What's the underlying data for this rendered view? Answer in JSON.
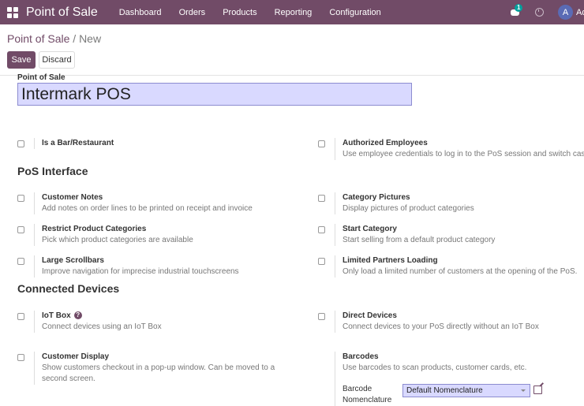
{
  "navbar": {
    "brand": "Point of Sale",
    "menu": [
      "Dashboard",
      "Orders",
      "Products",
      "Reporting",
      "Configuration"
    ],
    "chat_badge": "1",
    "avatar_letter": "A",
    "user_name": "Ad"
  },
  "breadcrumb": {
    "parent": "Point of Sale",
    "separator": "/",
    "current": "New"
  },
  "buttons": {
    "save": "Save",
    "discard": "Discard"
  },
  "form": {
    "name_label": "Point of Sale",
    "name_value": "Intermark POS"
  },
  "settings": {
    "bar_restaurant": {
      "title": "Is a Bar/Restaurant",
      "checked": false
    },
    "authorized_employees": {
      "title": "Authorized Employees",
      "desc": "Use employee credentials to log in to the PoS session and switch cashier",
      "checked": false
    },
    "pos_interface_title": "PoS Interface",
    "customer_notes": {
      "title": "Customer Notes",
      "desc": "Add notes on order lines to be printed on receipt and invoice",
      "checked": false
    },
    "category_pictures": {
      "title": "Category Pictures",
      "desc": "Display pictures of product categories",
      "checked": false
    },
    "restrict_categories": {
      "title": "Restrict Product Categories",
      "desc": "Pick which product categories are available",
      "checked": false
    },
    "start_category": {
      "title": "Start Category",
      "desc": "Start selling from a default product category",
      "checked": false
    },
    "large_scrollbars": {
      "title": "Large Scrollbars",
      "desc": "Improve navigation for imprecise industrial touchscreens",
      "checked": false
    },
    "limited_partners": {
      "title": "Limited Partners Loading",
      "desc": "Only load a limited number of customers at the opening of the PoS.",
      "checked": false
    },
    "connected_devices_title": "Connected Devices",
    "iot_box": {
      "title": "IoT Box",
      "desc": "Connect devices using an IoT Box",
      "checked": false
    },
    "direct_devices": {
      "title": "Direct Devices",
      "desc": "Connect devices to your PoS directly without an IoT Box",
      "checked": false
    },
    "customer_display": {
      "title": "Customer Display",
      "desc": "Show customers checkout in a pop-up window. Can be moved to a second screen.",
      "checked": false
    },
    "barcodes": {
      "title": "Barcodes",
      "desc": "Use barcodes to scan products, customer cards, etc.",
      "nomenclature_label": "Barcode Nomenclature",
      "nomenclature_value": "Default Nomenclature"
    }
  }
}
